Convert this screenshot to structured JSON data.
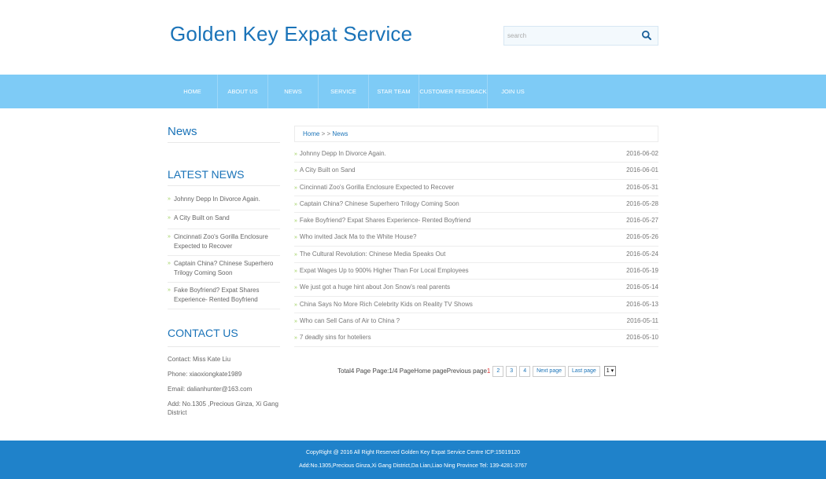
{
  "header": {
    "site_title": "Golden Key Expat Service",
    "search_placeholder": "search"
  },
  "nav": {
    "items": [
      "HOME",
      "ABOUT US",
      "NEWS",
      "SERVICE",
      "STAR TEAM",
      "CUSTOMER FEEDBACK",
      "JOIN US"
    ]
  },
  "sidebar": {
    "news_title": "News",
    "latest_title": "LATEST NEWS",
    "latest": [
      "Johnny Depp In Divorce Again.",
      "A City Built on Sand",
      "Cincinnati Zoo's Gorilla Enclosure Expected to Recover",
      "Captain China? Chinese Superhero Trilogy Coming Soon",
      "Fake Boyfriend? Expat Shares Experience- Rented Boyfriend"
    ],
    "contact_title": "CONTACT US",
    "contact": [
      "Contact: Miss Kate Liu",
      "Phone: xiaoxiongkate1989",
      "Email: dalianhunter@163.com",
      "Add: No.1305 ,Precious Ginza, Xi Gang District"
    ]
  },
  "breadcrumb": {
    "home": "Home",
    "separator": "> >",
    "current": "News"
  },
  "news": [
    {
      "title": "Johnny Depp In Divorce Again.",
      "date": "2016-06-02"
    },
    {
      "title": "A City Built on Sand",
      "date": "2016-06-01"
    },
    {
      "title": "Cincinnati Zoo's Gorilla Enclosure Expected to Recover",
      "date": "2016-05-31"
    },
    {
      "title": "Captain China? Chinese Superhero Trilogy Coming Soon",
      "date": "2016-05-28"
    },
    {
      "title": "Fake Boyfriend? Expat Shares Experience- Rented Boyfriend",
      "date": "2016-05-27"
    },
    {
      "title": "Who invited Jack Ma to the White House?",
      "date": "2016-05-26"
    },
    {
      "title": "The Cultural Revolution: Chinese Media Speaks Out",
      "date": "2016-05-24"
    },
    {
      "title": "Expat Wages Up to 900% Higher Than For Local Employees",
      "date": "2016-05-19"
    },
    {
      "title": "We just got a huge hint about Jon Snow's real parents",
      "date": "2016-05-14"
    },
    {
      "title": "China Says No More Rich Celebrity Kids on Reality TV Shows",
      "date": "2016-05-13"
    },
    {
      "title": "Who can Sell Cans of Air to China ?",
      "date": "2016-05-11"
    },
    {
      "title": "7 deadly sins for hoteliers",
      "date": "2016-05-10"
    }
  ],
  "pager": {
    "summary": "Total4 Page Page:1/4 PageHome pagePrevious page",
    "current": "1",
    "pages": [
      "2",
      "3",
      "4"
    ],
    "next": "Next page",
    "last": "Last page",
    "select_value": "1"
  },
  "footer": {
    "line1": "CopyRight @ 2016 All Right Reserved Golden Key Expat Service Centre  ICP:15019120",
    "line2": "Add:No.1305,Precious Ginza,Xi Gang District,Da Lian,Liao Ning Province Tel: 139-4281-3767"
  },
  "colors": {
    "brand_blue": "#1a73b8",
    "nav_bg": "#7ecbf6",
    "footer_bg": "#1f82ca",
    "bullet_green": "#9ccf5a"
  }
}
